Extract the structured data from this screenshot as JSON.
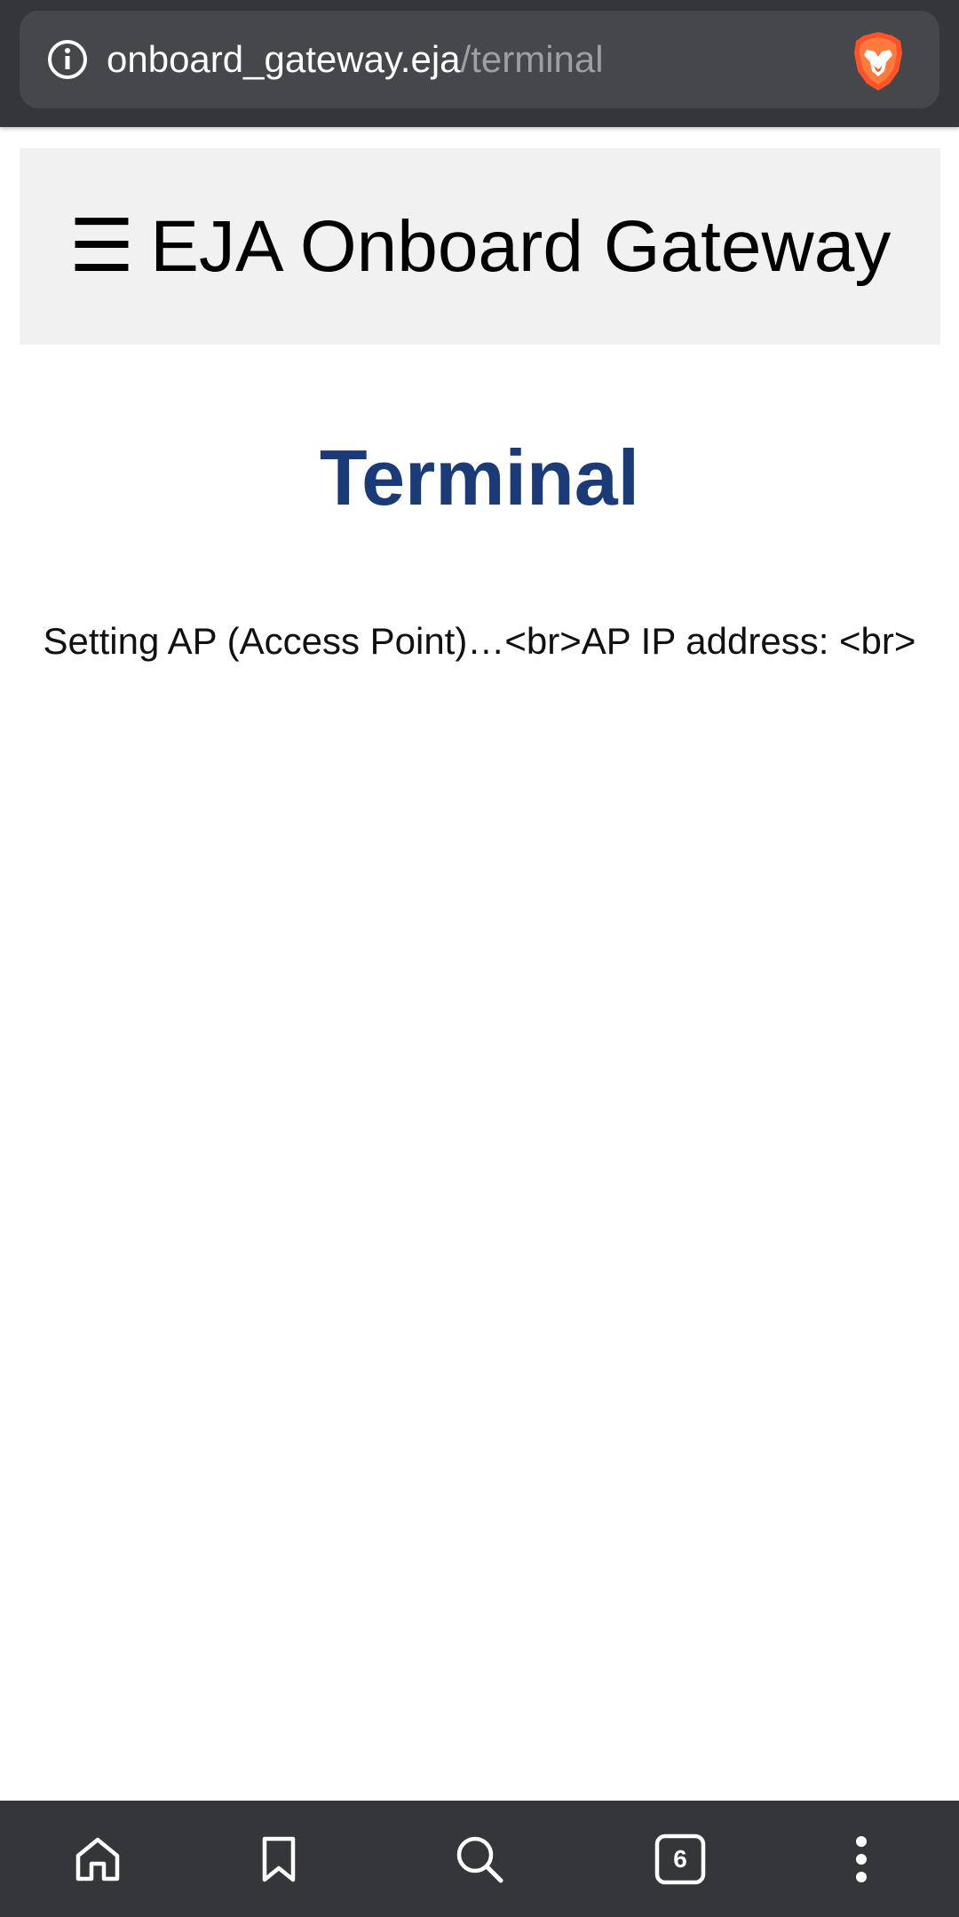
{
  "browser": {
    "url_host": "onboard_gateway.eja",
    "url_path": "/terminal",
    "tab_count": "6",
    "icons": {
      "site_info": "info-icon",
      "brave": "brave-lion-icon",
      "home": "home-icon",
      "bookmarks": "bookmark-icon",
      "search": "search-icon",
      "tabs": "tabs-icon",
      "menu": "more-vert-icon"
    },
    "colors": {
      "bar_background": "#35363a",
      "urlbar_background": "#45474b",
      "brave_orange": "#fb542b"
    }
  },
  "site": {
    "menu_glyph": "☰",
    "header_title": "EJA Onboard Gateway",
    "header_background": "#f1f1f1"
  },
  "main": {
    "page_title": "Terminal",
    "page_title_color": "#1b3a78",
    "terminal_text": "Setting AP (Access Point)…<br>AP IP address: <br>"
  }
}
